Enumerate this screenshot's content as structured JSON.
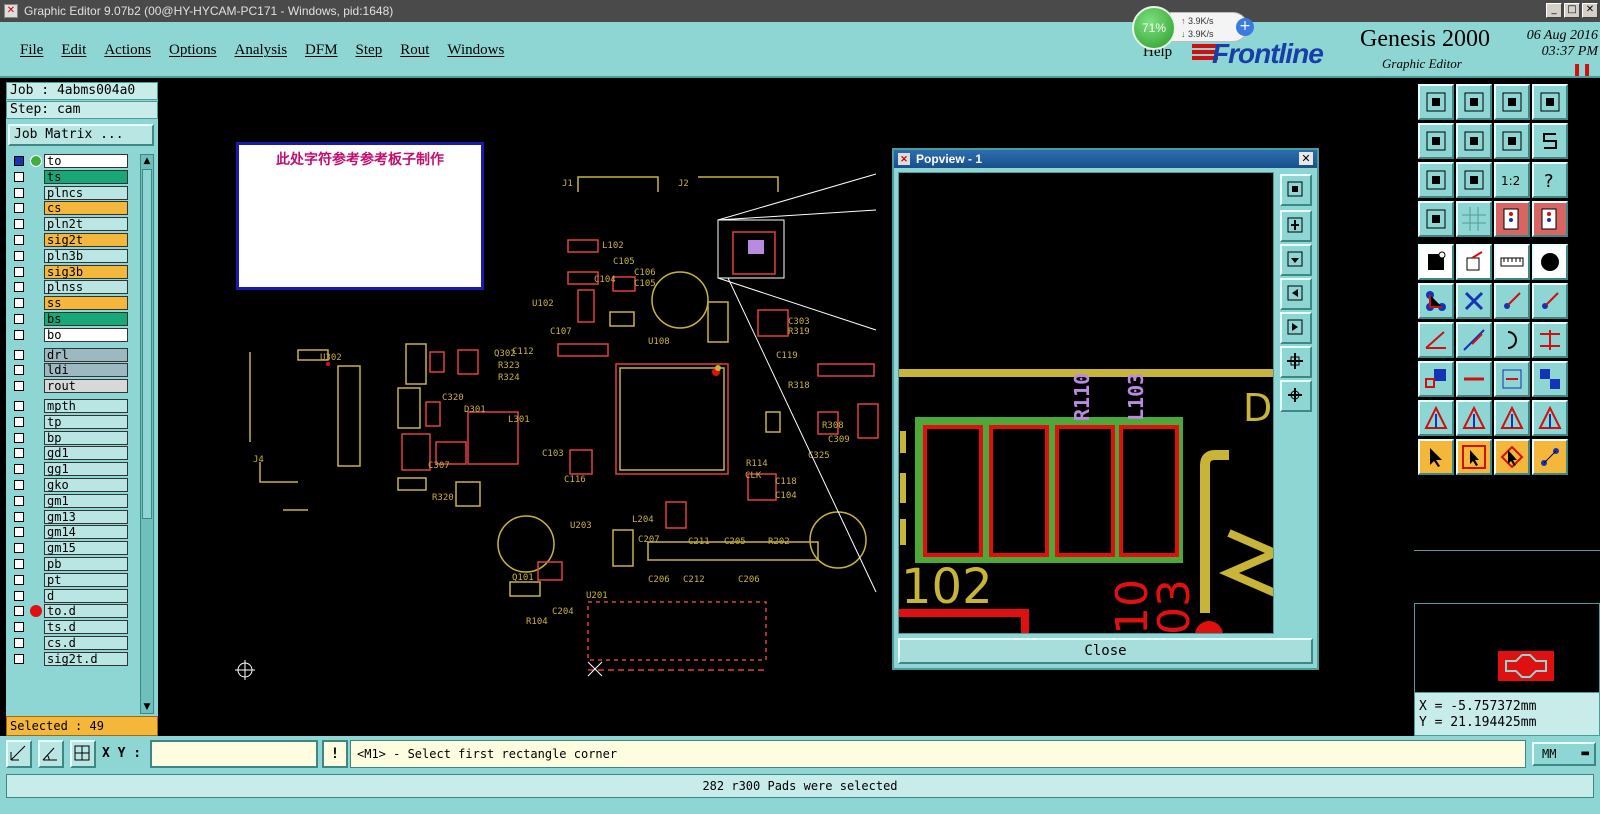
{
  "window": {
    "title": "Graphic Editor 9.07b2 (00@HY-HYCAM-PC171 - Windows, pid:1648)"
  },
  "menu": [
    "File",
    "Edit",
    "Actions",
    "Options",
    "Analysis",
    "DFM",
    "Step",
    "Rout",
    "Windows"
  ],
  "help_label": "Help",
  "brand": {
    "logo": "Frontline",
    "product": "Genesis 2000",
    "subtitle": "Graphic Editor",
    "date": "06 Aug 2016",
    "time": "03:37 PM"
  },
  "netmon": {
    "percent": "71%",
    "up": "3.9K/s",
    "down": "3.9K/s"
  },
  "job": {
    "job_label": "Job : 4abms004a0",
    "step_label": "Step: cam",
    "matrix_button": "Job Matrix ..."
  },
  "layers": [
    {
      "name": "to",
      "color": "#ffffff",
      "checked": true,
      "mark": "icon",
      "flag": "◈"
    },
    {
      "name": "ts",
      "color": "#18a878",
      "checked": false
    },
    {
      "name": "plncs",
      "color": "#b9e6e3",
      "checked": false
    },
    {
      "name": "cs",
      "color": "#f5b73a",
      "checked": false,
      "flag": "✸"
    },
    {
      "name": "pln2t",
      "color": "#b9e6e3",
      "checked": false
    },
    {
      "name": "sig2t",
      "color": "#f5b73a",
      "checked": false,
      "flag": "✸"
    },
    {
      "name": "pln3b",
      "color": "#b9e6e3",
      "checked": false
    },
    {
      "name": "sig3b",
      "color": "#f5b73a",
      "checked": false
    },
    {
      "name": "plnss",
      "color": "#b9e6e3",
      "checked": false
    },
    {
      "name": "ss",
      "color": "#f5b73a",
      "checked": false,
      "flag": "✸"
    },
    {
      "name": "bs",
      "color": "#18a878",
      "checked": false
    },
    {
      "name": "bo",
      "color": "#ffffff",
      "checked": false,
      "flag": "✸"
    },
    {
      "name": "drl",
      "color": "#9db8c0",
      "checked": false
    },
    {
      "name": "ldi",
      "color": "#9db8c0",
      "checked": false
    },
    {
      "name": "rout",
      "color": "#d8d8d8",
      "checked": false
    },
    {
      "name": "mpth",
      "color": "#b9e6e3",
      "checked": false
    },
    {
      "name": "tp",
      "color": "#b9e6e3",
      "checked": false
    },
    {
      "name": "bp",
      "color": "#b9e6e3",
      "checked": false
    },
    {
      "name": "gd1",
      "color": "#b9e6e3",
      "checked": false,
      "flag": "✸"
    },
    {
      "name": "gg1",
      "color": "#b9e6e3",
      "checked": false,
      "flag": "✸"
    },
    {
      "name": "gko",
      "color": "#b9e6e3",
      "checked": false,
      "flag": "✸"
    },
    {
      "name": "gm1",
      "color": "#b9e6e3",
      "checked": false,
      "flag": "✸"
    },
    {
      "name": "gm13",
      "color": "#b9e6e3",
      "checked": false,
      "flag": "✸"
    },
    {
      "name": "gm14",
      "color": "#b9e6e3",
      "checked": false
    },
    {
      "name": "gm15",
      "color": "#b9e6e3",
      "checked": false
    },
    {
      "name": "pb",
      "color": "#b9e6e3",
      "checked": false
    },
    {
      "name": "pt",
      "color": "#b9e6e3",
      "checked": false
    },
    {
      "name": "d",
      "color": "#b9e6e3",
      "checked": false
    },
    {
      "name": "to.d",
      "color": "#b9e6e3",
      "checked": false,
      "mark": "dot",
      "flag": "✸"
    },
    {
      "name": "ts.d",
      "color": "#b9e6e3",
      "checked": false
    },
    {
      "name": "cs.d",
      "color": "#b9e6e3",
      "checked": false,
      "flag": "✸"
    },
    {
      "name": "sig2t.d",
      "color": "#b9e6e3",
      "checked": false,
      "flag": "✸"
    }
  ],
  "selected_label": "Selected : 49",
  "canvas_note": "此处字符参考参考板子制作",
  "popview": {
    "title": "Popview - 1",
    "close_label": "Close",
    "labels": [
      "R110",
      "L103",
      "102",
      "10",
      "03"
    ]
  },
  "coords": {
    "x": "X = -5.757372mm",
    "y": "Y = 21.194425mm"
  },
  "xy_label": "X Y :",
  "xy_value": "",
  "warn_symbol": "!",
  "prompt": "<M1> - Select first rectangle corner",
  "units": "MM",
  "status": "282 r300 Pads were selected",
  "colors": {
    "panel": "#8ed6d3",
    "trace": "#c9b43a",
    "pad": "#e01010",
    "accent": "#f5b73a",
    "silk": "#b98be0"
  }
}
